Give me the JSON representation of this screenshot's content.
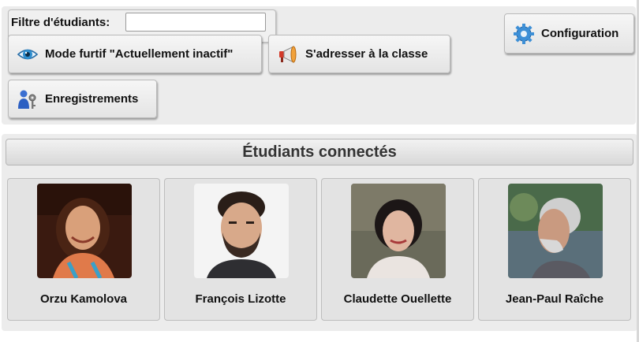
{
  "filter": {
    "label": "Filtre d'étudiants:",
    "value": ""
  },
  "toolbar": {
    "stealth_label": "Mode furtif \"Actuellement inactif\"",
    "announce_label": "S'adresser à la classe",
    "records_label": "Enregistrements",
    "config_label": "Configuration"
  },
  "icons": {
    "stealth": "eye-icon",
    "announce": "megaphone-icon",
    "records": "users-with-key-icon",
    "config": "gear-icon"
  },
  "students": {
    "title": "Étudiants connectés",
    "items": [
      {
        "name": "Orzu Kamolova"
      },
      {
        "name": "François Lizotte"
      },
      {
        "name": "Claudette Ouellette"
      },
      {
        "name": "Jean-Paul Raîche"
      }
    ]
  },
  "colors": {
    "panel": "#ececec",
    "card": "#e3e3e3",
    "header_text": "#333333"
  }
}
